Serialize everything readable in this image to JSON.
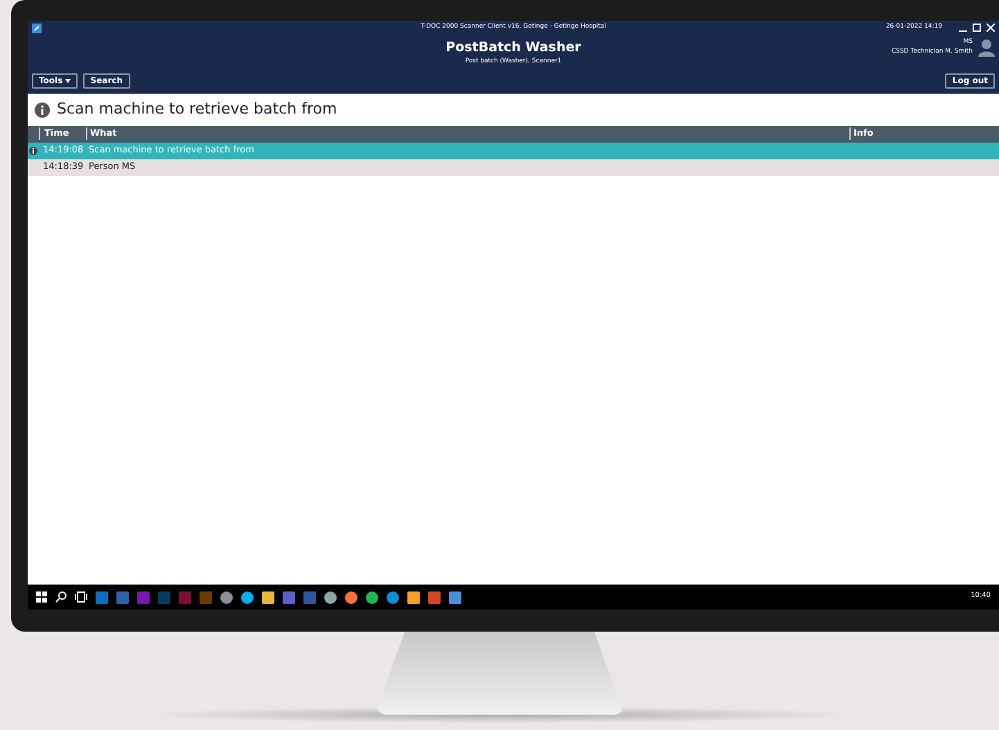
{
  "window": {
    "title": "T-DOC 2000 Scanner Client v16, Getinge - Getinge Hospital",
    "datetime": "26-01-2022 14:19"
  },
  "header": {
    "title": "PostBatch Washer",
    "subtitle": "Post batch (Washer), Scanner1",
    "user_initials": "MS",
    "user_name": "CSSD Technician M. Smith",
    "logout": "Log out"
  },
  "toolbar": [
    {
      "label": "Tools",
      "kind": "dropdown"
    },
    {
      "label": "Search",
      "kind": "plain"
    }
  ],
  "message": "Scan machine to retrieve batch from",
  "table": {
    "columns": [
      "Time",
      "What",
      "Info"
    ],
    "rows": [
      {
        "time": "14:19:08",
        "what": "Scan machine to retrieve batch from",
        "kind": "info",
        "selected": true
      },
      {
        "time": "14:18:39",
        "what": "Person MS",
        "kind": "plain",
        "selected": false
      }
    ]
  },
  "taskbar": {
    "clock": "10:40",
    "apps": [
      {
        "kind": "tile",
        "color": "#0f6cbd"
      },
      {
        "kind": "tile",
        "color": "#2f5fa8"
      },
      {
        "kind": "tile",
        "color": "#7719aa"
      },
      {
        "kind": "tile",
        "color": "#0b3a5e"
      },
      {
        "kind": "tile",
        "color": "#7a0f3a"
      },
      {
        "kind": "tile",
        "color": "#6b3a00"
      },
      {
        "kind": "round",
        "color": "#8a8f99"
      },
      {
        "kind": "round",
        "color": "#00aff0"
      },
      {
        "kind": "tile",
        "color": "#e8b73a"
      },
      {
        "kind": "tile",
        "color": "#5b5fc7"
      },
      {
        "kind": "tile",
        "color": "#2b579a"
      },
      {
        "kind": "round",
        "color": "#8fa3a8"
      },
      {
        "kind": "round",
        "color": "#ff7139"
      },
      {
        "kind": "round",
        "color": "#1db954"
      },
      {
        "kind": "round",
        "color": "#0c8fd6"
      },
      {
        "kind": "tile",
        "color": "#f7a128"
      },
      {
        "kind": "tile",
        "color": "#d24726"
      },
      {
        "kind": "tile",
        "color": "#4a90d9"
      }
    ]
  }
}
